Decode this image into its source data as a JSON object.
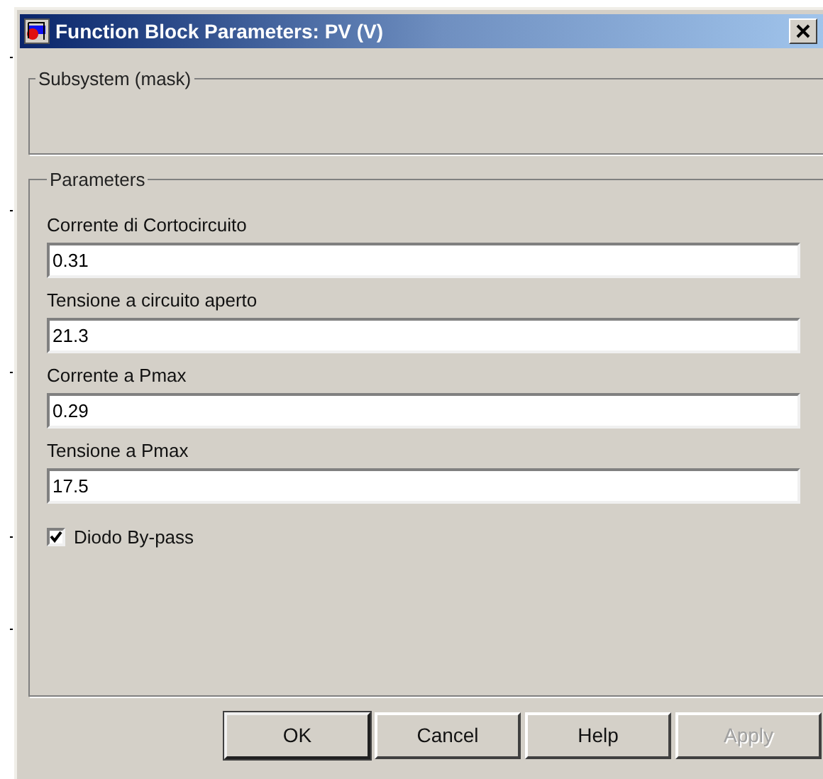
{
  "window": {
    "title": "Function Block Parameters: PV (V)"
  },
  "subsystem": {
    "title": "Subsystem (mask)"
  },
  "parameters": {
    "title": "Parameters",
    "fields": [
      {
        "label": "Corrente di Cortocircuito",
        "value": "0.31"
      },
      {
        "label": "Tensione a circuito aperto",
        "value": "21.3"
      },
      {
        "label": "Corrente a Pmax",
        "value": "0.29"
      },
      {
        "label": "Tensione a Pmax",
        "value": "17.5"
      }
    ],
    "checkbox": {
      "label": "Diodo By-pass",
      "checked": true
    }
  },
  "buttons": [
    {
      "label": "OK",
      "disabled": false,
      "default": true
    },
    {
      "label": "Cancel",
      "disabled": false,
      "default": false
    },
    {
      "label": "Help",
      "disabled": false,
      "default": false
    },
    {
      "label": "Apply",
      "disabled": true,
      "default": false
    }
  ]
}
